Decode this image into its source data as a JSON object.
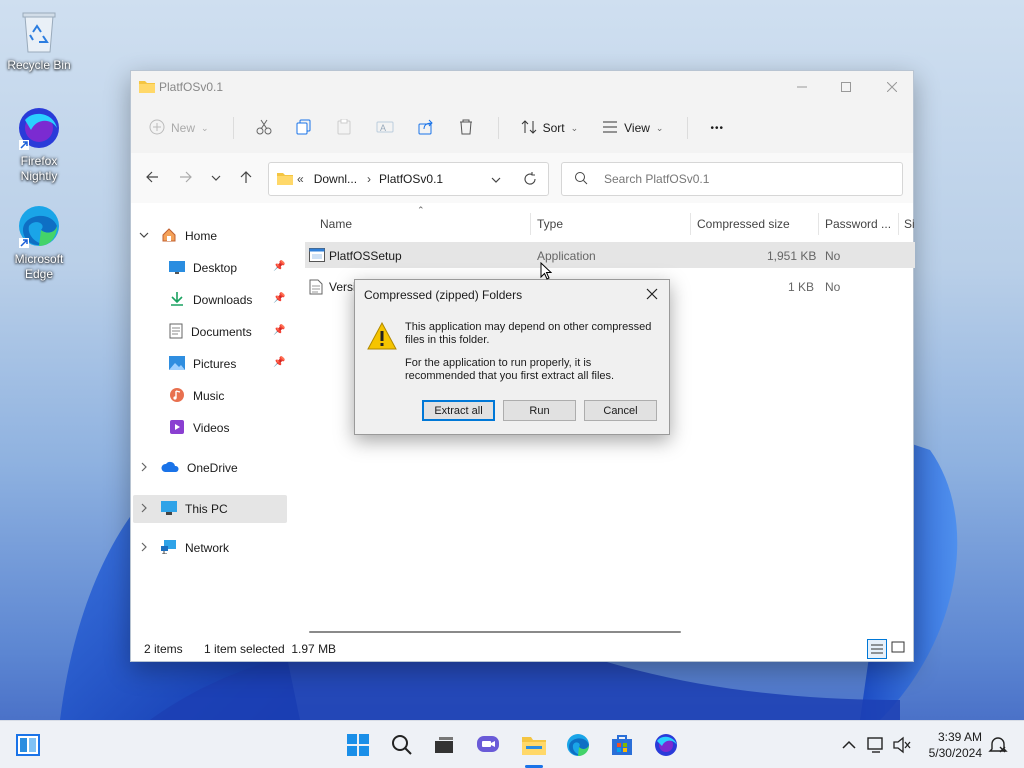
{
  "desktop": {
    "icons": [
      {
        "label": "Recycle Bin"
      },
      {
        "label": "Firefox Nightly"
      },
      {
        "label": "Microsoft Edge"
      }
    ]
  },
  "explorer": {
    "title": "PlatfOSv0.1",
    "toolbar": {
      "new_label": "New",
      "sort_label": "Sort",
      "view_label": "View",
      "more_label": "•••"
    },
    "breadcrumb": {
      "overflow": "«",
      "parent": "Downl...",
      "separator": "›",
      "current": "PlatfOSv0.1"
    },
    "search": {
      "placeholder": "Search PlatfOSv0.1"
    },
    "sidebar": {
      "home": "Home",
      "desktop": "Desktop",
      "downloads": "Downloads",
      "documents": "Documents",
      "pictures": "Pictures",
      "music": "Music",
      "videos": "Videos",
      "onedrive": "OneDrive",
      "thispc": "This PC",
      "network": "Network"
    },
    "columns": {
      "name": "Name",
      "type": "Type",
      "compressed_size": "Compressed size",
      "password": "Password ...",
      "size": "Si"
    },
    "files": [
      {
        "name": "PlatfOSSetup",
        "type": "Application",
        "compressed_size": "1,951 KB",
        "password": "No"
      },
      {
        "name": "Versi",
        "type": "",
        "compressed_size": "1 KB",
        "password": "No"
      }
    ],
    "status": {
      "items": "2 items",
      "selected": "1 item selected  1.97 MB"
    }
  },
  "dialog": {
    "title": "Compressed (zipped) Folders",
    "message1": "This application may depend on other compressed files in this folder.",
    "message2": "For the application to run properly, it is recommended that you first extract all files.",
    "buttons": {
      "extract": "Extract all",
      "run": "Run",
      "cancel": "Cancel"
    }
  },
  "taskbar": {
    "time": "3:39 AM",
    "date": "5/30/2024"
  },
  "colors": {
    "accent": "#0078d7",
    "selection": "#e5e5e5",
    "folder": "#f4c542"
  }
}
